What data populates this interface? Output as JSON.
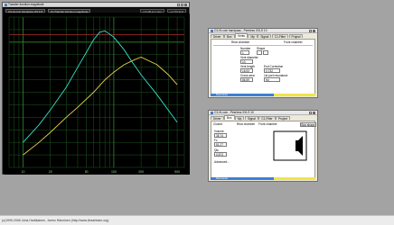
{
  "graph_window": {
    "title": "Transfer function magnitude",
    "dropdown_1": "C3-Hi-coin bandpass 2/3 1/3",
    "dropdown_2": "Fs Transfer function magnitude",
    "readout_1": "1.6 dB  at 1 kHz",
    "readout_2": "+1.776 kHz"
  },
  "chart_data": {
    "type": "line",
    "x_tick_labels": [
      "10",
      "20",
      "50",
      "100",
      "200",
      "500"
    ],
    "y_tick_labels": [],
    "xscale": "log",
    "grid": true,
    "series": [
      {
        "color": "#35e0c8",
        "x": [
          10,
          15,
          20,
          30,
          40,
          50,
          60,
          70,
          80,
          100,
          130,
          160,
          200,
          300,
          500
        ],
        "y": [
          -40,
          -33,
          -27,
          -18,
          -10,
          -4,
          1,
          4,
          4.5,
          2,
          -3,
          -8,
          -13,
          -21,
          -32
        ]
      },
      {
        "color": "#e8d24a",
        "x": [
          10,
          15,
          20,
          30,
          40,
          60,
          80,
          100,
          130,
          170,
          200,
          300,
          400,
          500
        ],
        "y": [
          -45,
          -40,
          -36,
          -30,
          -26,
          -20,
          -15,
          -12,
          -9,
          -7,
          -6,
          -9,
          -13,
          -17
        ]
      }
    ]
  },
  "speaker_window_1": {
    "title": "C3-Hi-coin bandpass - Peerless XXLS 10",
    "tabs": [
      "Driver",
      "Box",
      "Vents",
      "Mp",
      "Signal",
      "C1-Filter",
      "Project"
    ],
    "active_tab": "Vents",
    "left_header": "Rear chamber",
    "right_header": "Front chamber",
    "number_label": "Number",
    "number_value": "1",
    "shape_label": "Shape",
    "vent_diameter_label": "Vent diameter",
    "vent_diameter_value": "10",
    "vent_length_label": "Vent length",
    "vent_length_value": "16.00",
    "end_correction_label": "End Correction",
    "end_correction_value": "0.732",
    "cross_area_label": "Cross area",
    "cross_area_value": "86.59",
    "resonance_label": "1st port resonance",
    "resonance_value": "Hz",
    "status_text": "Resonance"
  },
  "speaker_window_2": {
    "title": "C3-Hi-coin - Peerless XXLS 10",
    "tabs": [
      "Driver",
      "Box",
      "Mp",
      "Signal",
      "C1-Filter",
      "Project"
    ],
    "active_tab": "Box",
    "closed_label": "Closed",
    "rear_header": "Rear chamber",
    "front_header": "Front chamber",
    "show_shape_button": "Box shape",
    "volume_label": "Volume",
    "volume_value": "35.74",
    "fxc_label": "Fc",
    "fxc_value": "51.27",
    "qtc_label": "Qtc",
    "qtc_value": "0.873",
    "advanced_label": "Advanced...",
    "status_text": "Resonance"
  },
  "statusbar": {
    "text": "(c)1999-2006 Juha Hartikainen, Jarmo Hänninen (http://www.linearteam.org)"
  }
}
